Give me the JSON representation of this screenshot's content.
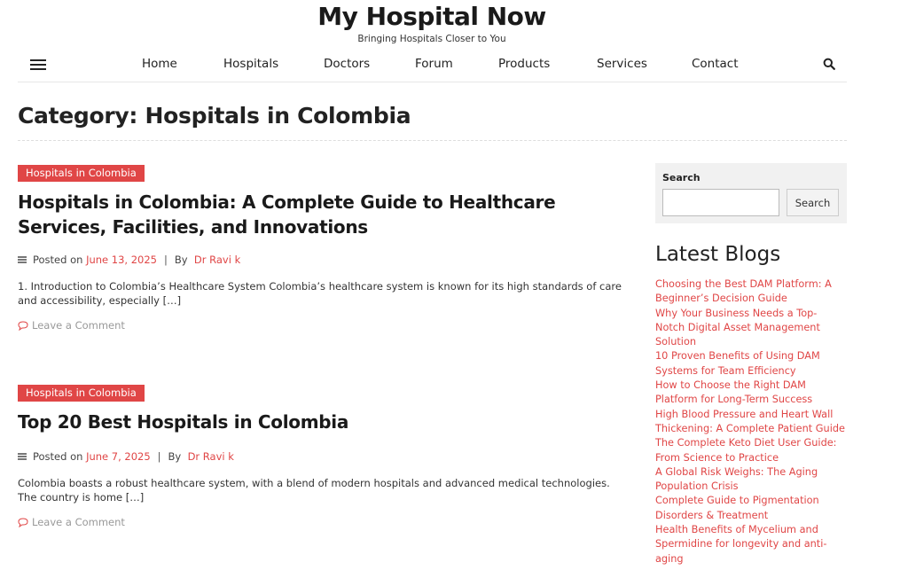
{
  "site": {
    "title": "My Hospital Now",
    "tagline": "Bringing Hospitals Closer to You"
  },
  "nav": {
    "items": [
      "Home",
      "Hospitals",
      "Doctors",
      "Forum",
      "Products",
      "Services",
      "Contact"
    ]
  },
  "category": {
    "title": "Category: Hospitals in Colombia"
  },
  "posts": [
    {
      "category": "Hospitals in Colombia",
      "title_line1": "Hospitals in Colombia: A Complete Guide to Healthcare",
      "title_line2": "Services, Facilities, and Innovations",
      "posted_on_label": "Posted on",
      "date": "June 13, 2025",
      "by_label": "By",
      "author": "Dr Ravi k",
      "excerpt_line1": "1. Introduction to Colombia’s Healthcare System Colombia’s healthcare system is known for its high standards of care",
      "excerpt_line2": "and accessibility, especially […]",
      "comment": "Leave a Comment"
    },
    {
      "category": "Hospitals in Colombia",
      "title_line1": "Top 20 Best Hospitals in Colombia",
      "posted_on_label": "Posted on",
      "date": "June 7, 2025",
      "by_label": "By",
      "author": "Dr Ravi k",
      "excerpt_line1": "Colombia boasts a robust healthcare system, with a blend of modern hospitals and advanced medical technologies.",
      "excerpt_line2": "The country is home […]",
      "comment": "Leave a Comment"
    }
  ],
  "sidebar": {
    "search_label": "Search",
    "search_placeholder": "",
    "search_button": "Search",
    "latest_title": "Latest Blogs",
    "latest_lines": [
      "Choosing the Best DAM Platform: A",
      "Beginner’s Decision Guide",
      "Why Your Business Needs a Top-",
      "Notch Digital Asset Management",
      "Solution",
      "10 Proven Benefits of Using DAM",
      "Systems for Team Efficiency",
      "How to Choose the Right DAM",
      "Platform for Long-Term Success",
      "High Blood Pressure and Heart Wall",
      "Thickening: A Complete Patient Guide",
      "The Complete Keto Diet User Guide:",
      "From Science to Practice",
      "A Global Risk Weighs: The Aging",
      "Population Crisis",
      "Complete Guide to Pigmentation",
      "Disorders & Treatment",
      "Health Benefits of Mycelium and",
      "Spermidine for longevity and anti-",
      "aging"
    ]
  },
  "colors": {
    "accent": "#e04646",
    "text": "#222222",
    "sidebar_bg": "#f1f1f1"
  },
  "icons": [
    "hamburger-menu-icon",
    "search-icon",
    "list-lines-icon",
    "comment-bubble-icon"
  ]
}
